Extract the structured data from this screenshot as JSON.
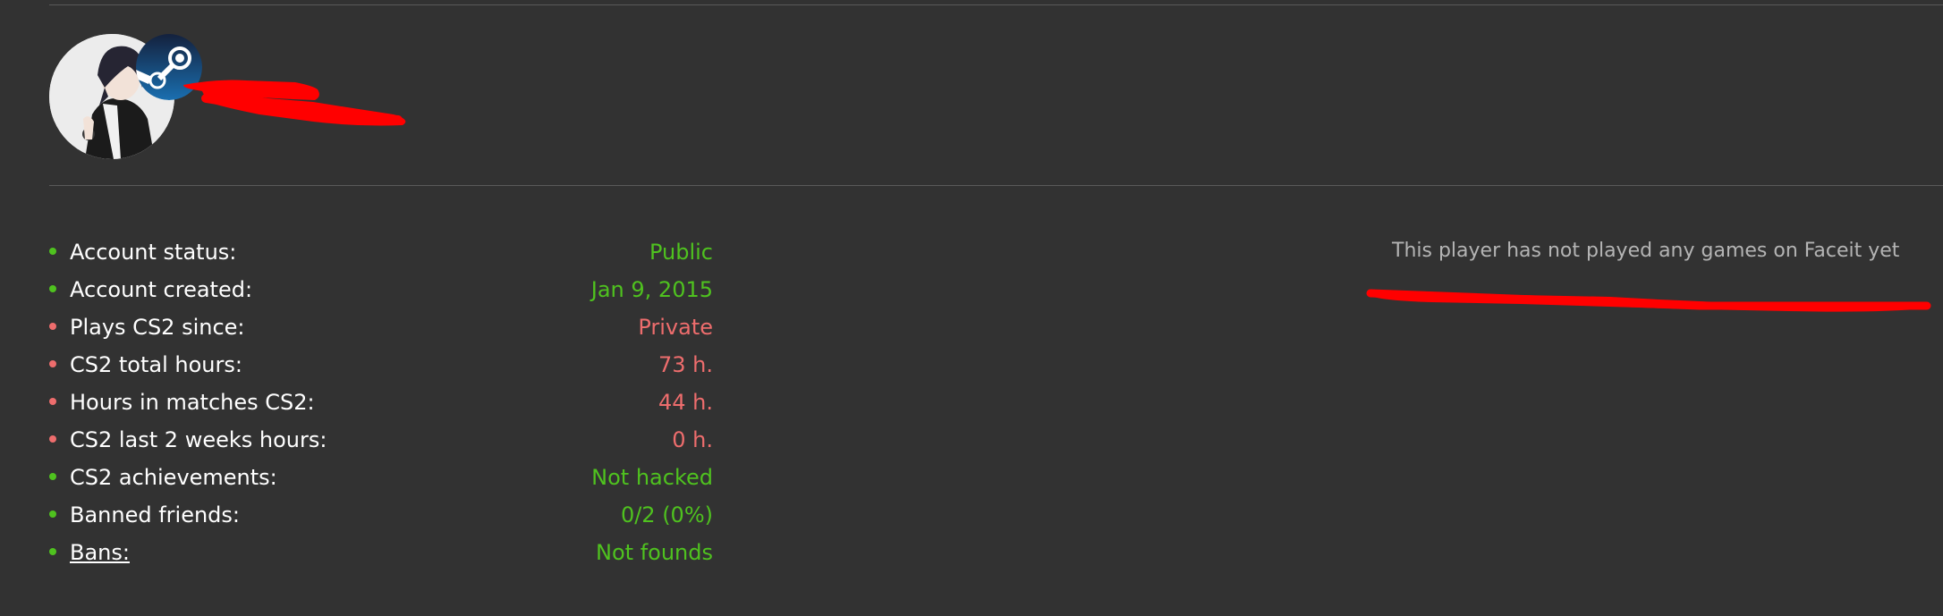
{
  "profile": {
    "avatar_icon": "anime-character-avatar",
    "platform_icon": "steam-icon"
  },
  "stats": [
    {
      "label": "Account status:",
      "value": "Public",
      "status": "good"
    },
    {
      "label": "Account created:",
      "value": "Jan 9, 2015",
      "status": "good"
    },
    {
      "label": "Plays CS2 since:",
      "value": "Private",
      "status": "bad"
    },
    {
      "label": "CS2 total hours:",
      "value": "73 h.",
      "status": "bad"
    },
    {
      "label": "Hours in matches CS2:",
      "value": "44 h.",
      "status": "bad"
    },
    {
      "label": "CS2 last 2 weeks hours:",
      "value": "0 h.",
      "status": "bad"
    },
    {
      "label": "CS2 achievements:",
      "value": "Not hacked",
      "status": "good"
    },
    {
      "label": "Banned friends:",
      "value": "0/2 (0%)",
      "status": "good"
    },
    {
      "label": "Bans:",
      "value": "Not founds",
      "status": "good"
    }
  ],
  "faceit": {
    "message": "This player has not played any games on Faceit yet"
  },
  "colors": {
    "background": "#323232",
    "good": "#4fc21f",
    "bad": "#ee6d6d",
    "redaction": "#ff0000"
  }
}
